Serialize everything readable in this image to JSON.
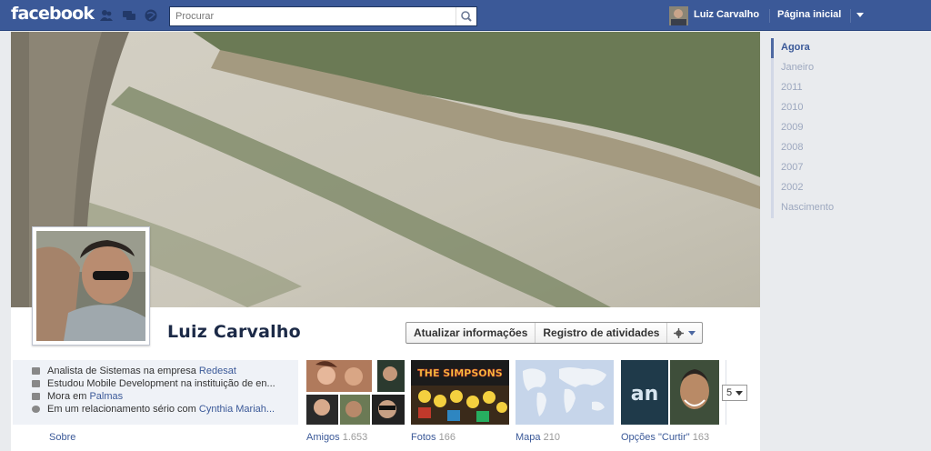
{
  "topbar": {
    "logo": "facebook",
    "search_placeholder": "Procurar",
    "user_name": "Luiz Carvalho",
    "home_link": "Página inicial"
  },
  "profile": {
    "name": "Luiz Carvalho",
    "buttons": {
      "update_info": "Atualizar informações",
      "activity_log": "Registro de atividades"
    }
  },
  "about": {
    "rows": [
      {
        "text": "Analista de Sistemas na empresa ",
        "link": "Redesat"
      },
      {
        "text": "Estudou Mobile Development na instituição de en...",
        "link": ""
      },
      {
        "text": "Mora em ",
        "link": "Palmas"
      },
      {
        "text": "Em um relacionamento sério com ",
        "link": "Cynthia Mariah..."
      }
    ],
    "label": "Sobre"
  },
  "tiles": [
    {
      "label": "Amigos",
      "count": "1.653"
    },
    {
      "label": "Fotos",
      "count": "166",
      "image_text": "THE SIMPSONS"
    },
    {
      "label": "Mapa",
      "count": "210"
    },
    {
      "label": "Opções \"Curtir\"",
      "count": "163",
      "image_text": "an"
    }
  ],
  "more_count": "5",
  "timeline": [
    {
      "label": "Agora",
      "active": true
    },
    {
      "label": "Janeiro"
    },
    {
      "label": "2011"
    },
    {
      "label": "2010"
    },
    {
      "label": "2009"
    },
    {
      "label": "2008"
    },
    {
      "label": "2007"
    },
    {
      "label": "2002"
    },
    {
      "label": "Nascimento"
    }
  ],
  "icons": [
    "friends-icon",
    "messages-icon",
    "notifications-icon",
    "search-icon",
    "gear-icon",
    "chevron-down-icon",
    "briefcase-icon",
    "graduation-icon",
    "home-icon",
    "heart-icon"
  ],
  "colors": {
    "brand": "#3b5998",
    "topbar_border": "#29447e",
    "name_text": "#1c2a47",
    "timeline_inactive": "#9da8bf"
  }
}
